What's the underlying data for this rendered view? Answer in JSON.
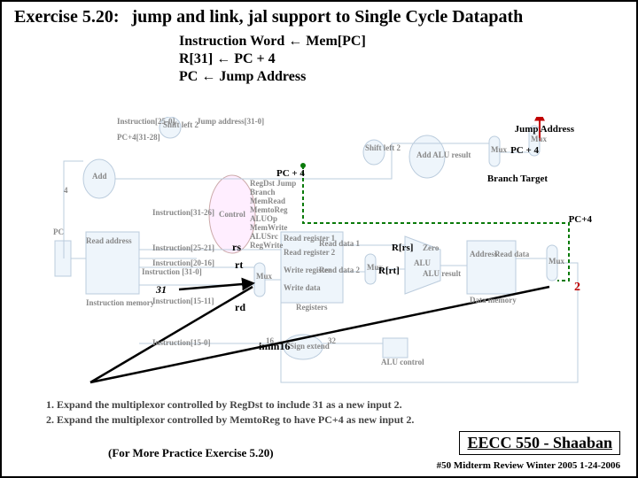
{
  "header": {
    "exercise_label": "Exercise 5.20:",
    "title": "jump and link, jal support to Single Cycle Datapath"
  },
  "rtl": {
    "line1a": "Instruction Word ",
    "line1_arrow": "←",
    "line1b": "  Mem[PC]",
    "line2a": "R[31] ",
    "line2_arrow": "←",
    "line2b": "  PC + 4",
    "line3a": "PC ",
    "line3_arrow": "←",
    "line3b": "  Jump Address"
  },
  "annot": {
    "jump_addr": "Jump Address",
    "pc4_top": "PC + 4",
    "pc4_right": "PC+4",
    "branch_target": "Branch Target",
    "const31": "31",
    "rs": "rs",
    "rt": "rt",
    "rd": "rd",
    "imm16": "imm16",
    "two": "2",
    "R_rs": "R[rs]",
    "R_rt": "R[rt]"
  },
  "faint": {
    "instr25_0": "Instruction[25-0]",
    "shiftleft2": "Shift left 2",
    "jaddr31_0": "Jump address[31-0]",
    "pc4_31_28": "PC+4[31-28]",
    "add": "Add",
    "four": "4",
    "pc": "PC",
    "readaddr": "Read address",
    "instrmem": "Instruction memory",
    "instr31_0": "Instruction [31-0]",
    "control": "Control",
    "regdst_jump": "RegDst Jump",
    "branch": "Branch",
    "memread": "MemRead",
    "memtoreg": "MemtoReg",
    "aluop": "ALUOp",
    "memwrite": "MemWrite",
    "alusrc": "ALUSrc",
    "regwrite": "RegWrite",
    "instr31_26": "Instruction[31-26]",
    "instr25_21": "Instruction[25-21]",
    "instr20_16": "Instruction[20-16]",
    "instr15_11": "Instruction[15-11]",
    "instr15_0": "Instruction[15-0]",
    "regs": "Registers",
    "readreg1": "Read register 1",
    "readreg2": "Read register 2",
    "writereg": "Write register",
    "writedata": "Write data",
    "readdata1": "Read data 1",
    "readdata2": "Read data 2",
    "signext": "Sign extend",
    "sixteen": "16",
    "thirtytwo": "32",
    "alu": "ALU",
    "aluresult": "ALU result",
    "zero": "Zero",
    "alucontrol": "ALU control",
    "datamem": "Data memory",
    "address": "Address",
    "readdata": "Read data",
    "mux": "Mux",
    "shiftleft2b": "Shift left 2",
    "addalu": "Add ALU result"
  },
  "mods": {
    "m1": "1.   Expand the multiplexor controlled by RegDst to include 31 as a new input 2.",
    "m2": "2.   Expand the multiplexor controlled by MemtoReg to have PC+4 as new input 2."
  },
  "footer": {
    "course": "EECC 550 - Shaaban",
    "meta": "#50   Midterm Review   Winter 2005  1-24-2006",
    "practice": "(For More Practice Exercise 5.20)"
  }
}
